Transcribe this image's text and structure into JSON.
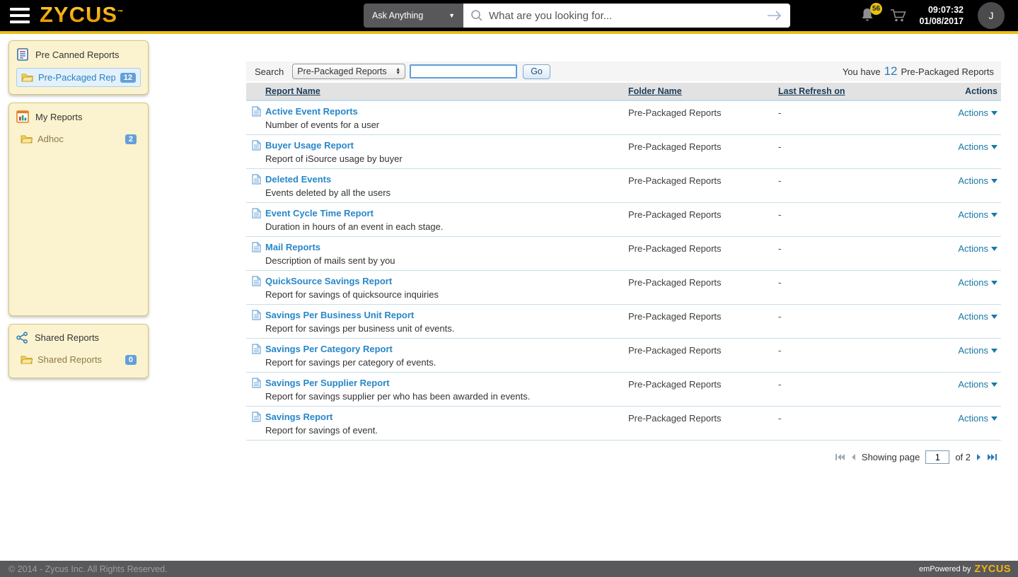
{
  "header": {
    "logo": "ZYCUS",
    "ask_anything": "Ask Anything",
    "search_placeholder": "What are you looking for...",
    "search_value": "",
    "notification_count": "56",
    "time": "09:07:32",
    "date": "01/08/2017",
    "avatar_initial": "J"
  },
  "sidebar": {
    "pre_canned": {
      "title": "Pre Canned Reports",
      "item": {
        "label": "Pre-Packaged Repo...",
        "count": "12"
      }
    },
    "my_reports": {
      "title": "My Reports",
      "item": {
        "label": "Adhoc",
        "count": "2"
      }
    },
    "shared": {
      "title": "Shared Reports",
      "item": {
        "label": "Shared Reports",
        "count": "0"
      }
    }
  },
  "toolbar": {
    "search_label": "Search",
    "folder_filter": "Pre-Packaged Reports",
    "search_value": "",
    "go_label": "Go",
    "summary": {
      "prefix": "You have",
      "count": "12",
      "suffix": "Pre-Packaged Reports"
    }
  },
  "table": {
    "headers": {
      "report": "Report Name",
      "folder": "Folder Name",
      "refresh": "Last Refresh on",
      "actions": "Actions"
    },
    "actions_label": "Actions",
    "rows": [
      {
        "name": "Active Event Reports",
        "description": "Number of events for a user",
        "folder": "Pre-Packaged Reports",
        "last_refresh": "-"
      },
      {
        "name": "Buyer Usage Report",
        "description": "Report of iSource usage by buyer",
        "folder": "Pre-Packaged Reports",
        "last_refresh": "-"
      },
      {
        "name": "Deleted Events",
        "description": "Events deleted by all the users",
        "folder": "Pre-Packaged Reports",
        "last_refresh": "-"
      },
      {
        "name": "Event Cycle Time Report",
        "description": "Duration in hours of an event in each stage.",
        "folder": "Pre-Packaged Reports",
        "last_refresh": "-"
      },
      {
        "name": "Mail Reports",
        "description": "Description of mails sent by you",
        "folder": "Pre-Packaged Reports",
        "last_refresh": "-"
      },
      {
        "name": "QuickSource Savings Report",
        "description": "Report for savings of quicksource inquiries",
        "folder": "Pre-Packaged Reports",
        "last_refresh": "-"
      },
      {
        "name": "Savings Per Business Unit Report",
        "description": "Report for savings per business unit of events.",
        "folder": "Pre-Packaged Reports",
        "last_refresh": "-"
      },
      {
        "name": "Savings Per Category Report",
        "description": "Report for savings per category of events.",
        "folder": "Pre-Packaged Reports",
        "last_refresh": "-"
      },
      {
        "name": "Savings Per Supplier Report",
        "description": "Report for savings supplier per who has been awarded in events.",
        "folder": "Pre-Packaged Reports",
        "last_refresh": "-"
      },
      {
        "name": "Savings Report",
        "description": "Report for savings of event.",
        "folder": "Pre-Packaged Reports",
        "last_refresh": "-"
      }
    ]
  },
  "pagination": {
    "prefix": "Showing page",
    "page": "1",
    "suffix": "of 2"
  },
  "footer": {
    "copyright": "© 2014 - Zycus Inc. All Rights Reserved.",
    "empowered": "emPowered by",
    "brand": "ZYCUS"
  },
  "colors": {
    "accent_blue": "#2A7AB5",
    "link_blue": "#2787C9",
    "badge_blue": "#64A0D8",
    "brand_yellow": "#F2B310",
    "panel_yellow": "#FBF3CF"
  }
}
